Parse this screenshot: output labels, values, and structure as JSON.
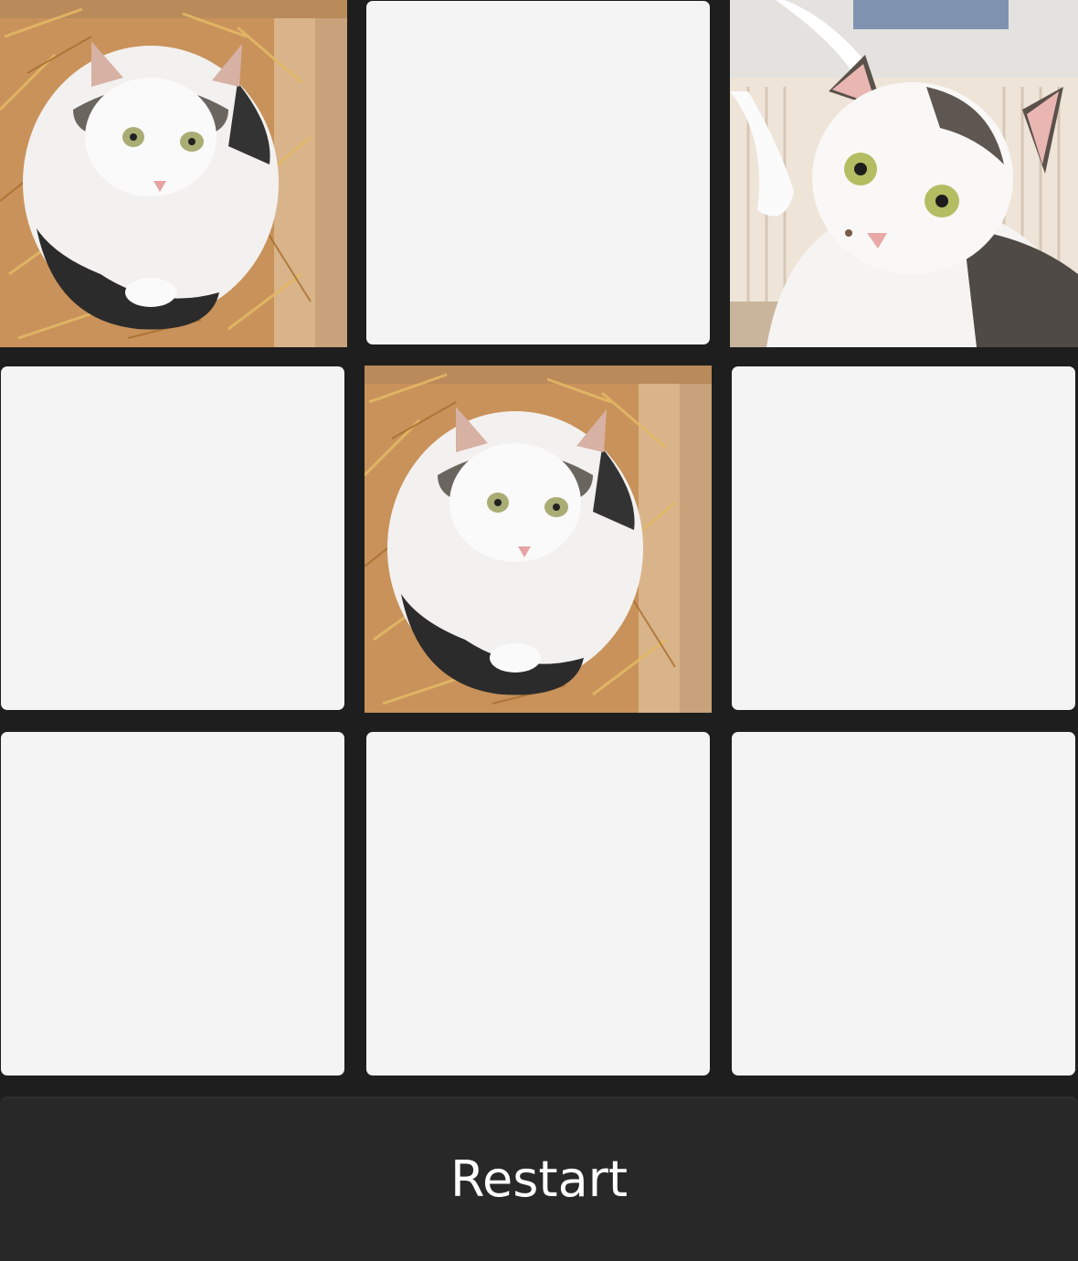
{
  "board": {
    "cards": [
      {
        "state": "revealed",
        "image": "cat-in-straw-box"
      },
      {
        "state": "hidden"
      },
      {
        "state": "revealed",
        "image": "cat-by-radiator"
      },
      {
        "state": "hidden"
      },
      {
        "state": "revealed",
        "image": "cat-in-straw-box"
      },
      {
        "state": "hidden"
      },
      {
        "state": "hidden"
      },
      {
        "state": "hidden"
      },
      {
        "state": "hidden"
      }
    ]
  },
  "restart": {
    "label": "Restart"
  },
  "colors": {
    "background": "#1e1e1e",
    "card_back": "#f4f4f4",
    "button_bg": "#282828",
    "button_text": "#ffffff"
  }
}
